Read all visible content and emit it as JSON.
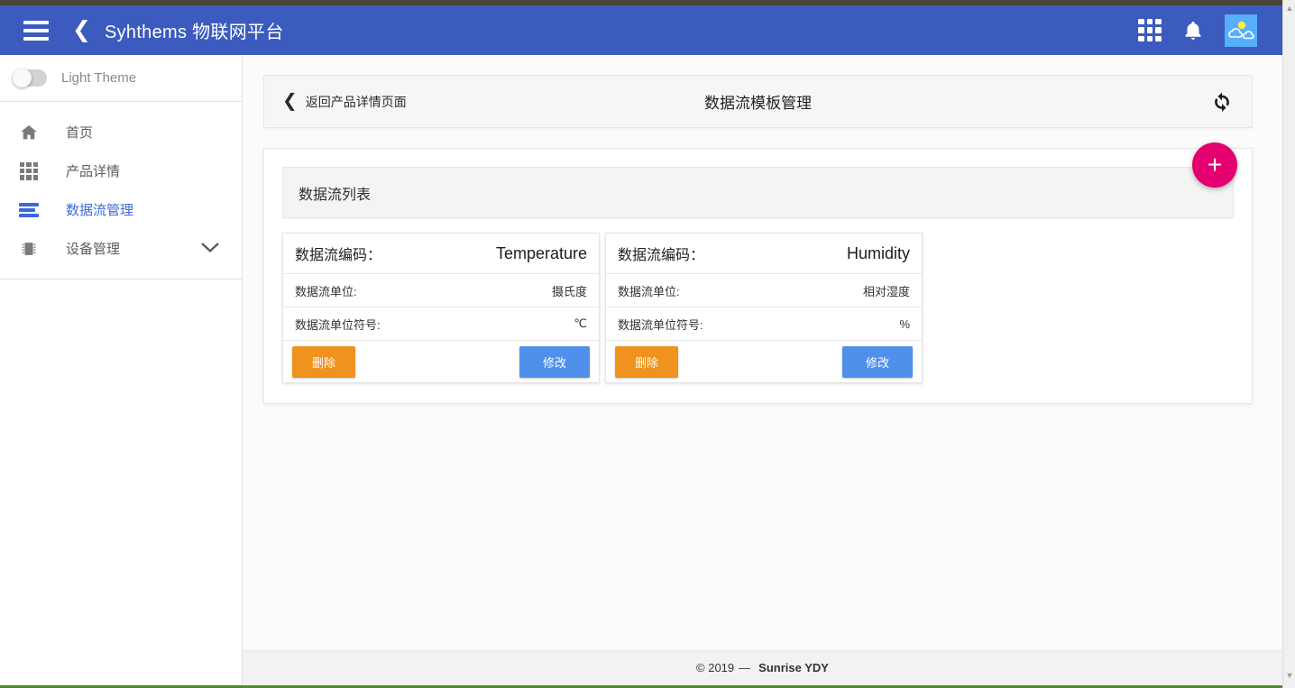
{
  "appbar": {
    "menu_icon": "hamburger-icon",
    "back_icon": "chevron-left-icon",
    "brand": "Syhthems 物联网平台",
    "apps_icon": "grid-apps-icon",
    "notifications_icon": "bell-icon",
    "avatar_icon": "weather-avatar-icon",
    "background_color": "#3b5bbf"
  },
  "sidebar": {
    "theme_toggle": {
      "label": "Light Theme",
      "state": "off"
    },
    "items": [
      {
        "label": "首页",
        "icon": "home-icon",
        "active": false,
        "expandable": false
      },
      {
        "label": "产品详情",
        "icon": "grid-dots-icon",
        "active": false,
        "expandable": false
      },
      {
        "label": "数据流管理",
        "icon": "stream-bars-icon",
        "active": true,
        "expandable": false
      },
      {
        "label": "设备管理",
        "icon": "chip-icon",
        "active": false,
        "expandable": true,
        "chevron": "▼"
      }
    ],
    "active_color": "#3b68e0"
  },
  "page_header": {
    "back_label": "返回产品详情页面",
    "back_icon": "chevron-left-icon",
    "title": "数据流模板管理",
    "refresh_icon": "refresh-sync-icon"
  },
  "panel": {
    "list_title": "数据流列表",
    "add_button": {
      "label": "+",
      "icon": "plus-icon",
      "color": "#e4006f"
    },
    "labels": {
      "code": "数据流编码：",
      "unit": "数据流单位:",
      "unit_symbol": "数据流单位符号:"
    },
    "buttons": {
      "delete": "删除",
      "edit": "修改",
      "delete_color": "#f0921e",
      "edit_color": "#4f91ea"
    },
    "cards": [
      {
        "code": "Temperature",
        "unit": "摄氏度",
        "unit_symbol": "℃"
      },
      {
        "code": "Humidity",
        "unit": "相对湿度",
        "unit_symbol": "%"
      }
    ]
  },
  "footer": {
    "copyright": "© 2019",
    "dash": "—",
    "company": "Sunrise YDY"
  }
}
